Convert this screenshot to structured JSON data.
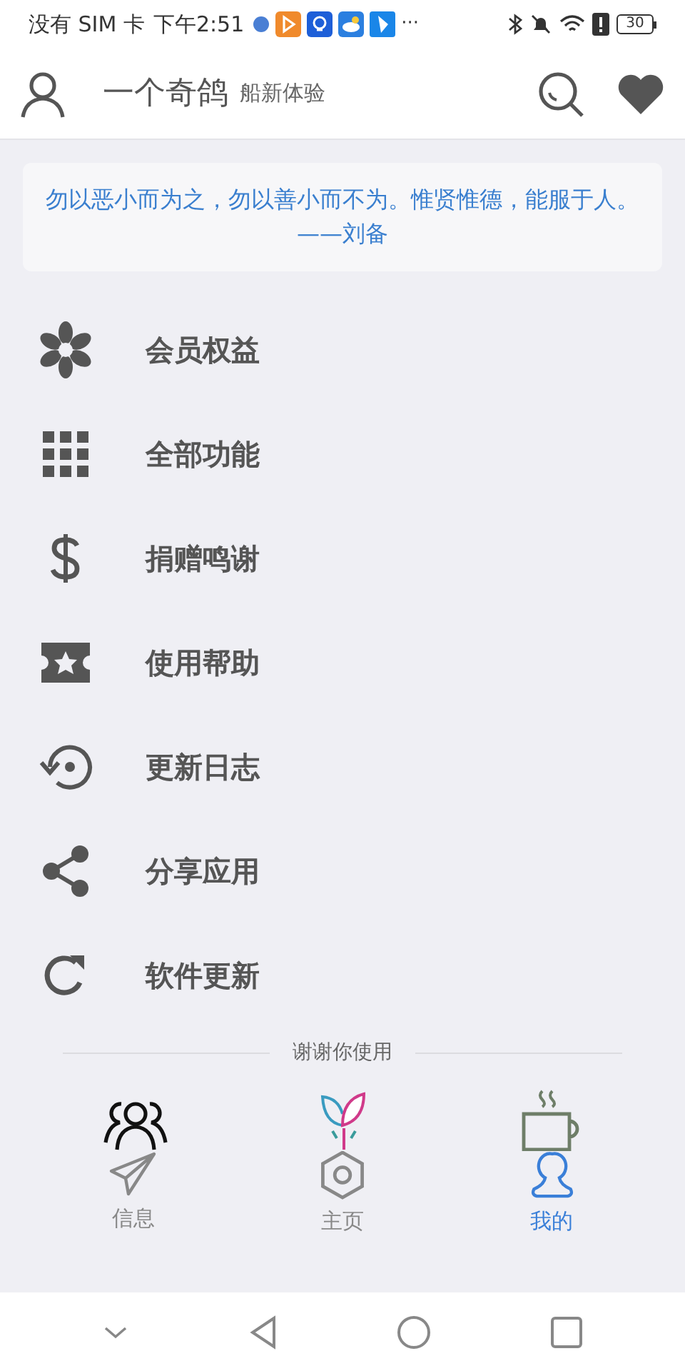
{
  "status_bar": {
    "carrier": "没有 SIM 卡",
    "time": "下午2:51",
    "more": "···",
    "battery": "30"
  },
  "header": {
    "title": "一个奇鸽",
    "subtitle": "船新体验"
  },
  "quote": "勿以恶小而为之，勿以善小而不为。惟贤惟德，能服于人。——刘备",
  "menu": [
    {
      "kind": "flower",
      "label": "会员权益"
    },
    {
      "kind": "grid",
      "label": "全部功能"
    },
    {
      "kind": "dollar",
      "label": "捐赠鸣谢"
    },
    {
      "kind": "ticket",
      "label": "使用帮助"
    },
    {
      "kind": "history",
      "label": "更新日志"
    },
    {
      "kind": "share",
      "label": "分享应用"
    },
    {
      "kind": "refresh",
      "label": "软件更新"
    }
  ],
  "footer_note": "谢谢你使用",
  "bottom_tabs": [
    {
      "kind": "send",
      "label": "信息",
      "selected": false
    },
    {
      "kind": "hexagon",
      "label": "主页",
      "selected": false
    },
    {
      "kind": "person",
      "label": "我的",
      "selected": true
    }
  ]
}
